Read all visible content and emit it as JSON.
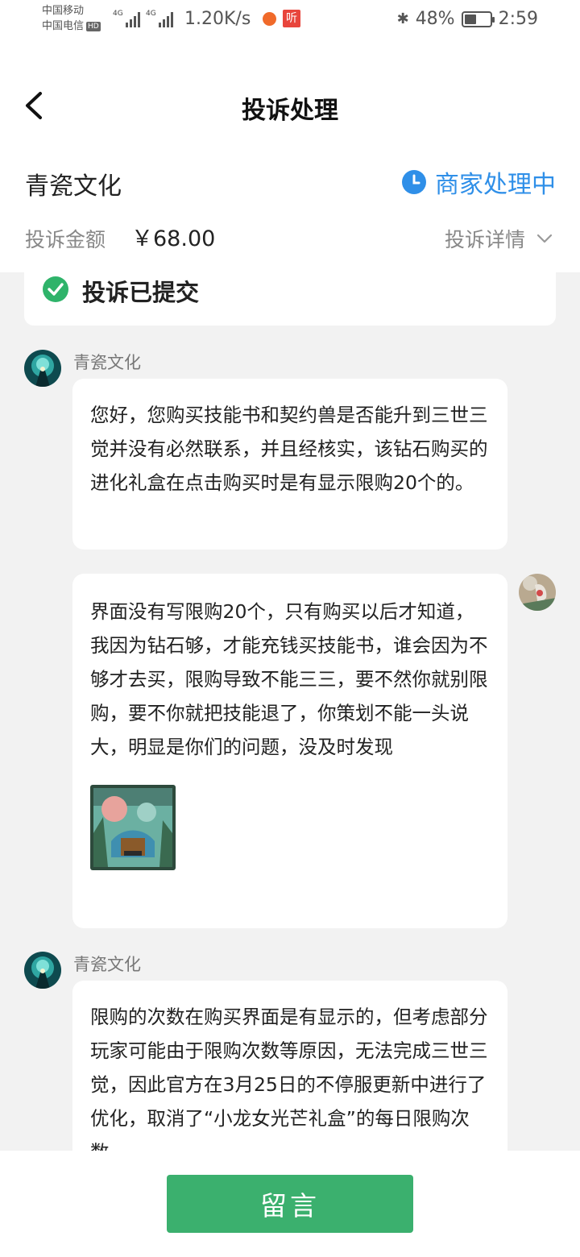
{
  "status_bar": {
    "carrier1": "中国移动",
    "carrier2": "中国电信",
    "hd_badge": "HD",
    "signal1_label": "4G",
    "signal2_label": "4G",
    "net_speed": "1.20K/s",
    "app_badge": "听",
    "battery": "48%",
    "battery_level": 0.48,
    "time": "2:59"
  },
  "header": {
    "title": "投诉处理",
    "merchant_name": "青瓷文化",
    "status_text": "商家处理中",
    "amount_label": "投诉金额",
    "amount_value": "￥68.00",
    "detail_link": "投诉详情"
  },
  "submitted": {
    "text": "投诉已提交"
  },
  "messages": [
    {
      "sender": "青瓷文化",
      "text": "您好，您购买技能书和契约兽是否能升到三世三觉并没有必然联系，并且经核实，该钻石购买的进化礼盒在点击购买时是有显示限购20个的。"
    },
    {
      "sender": "",
      "text": "界面没有写限购20个，只有购买以后才知道，我因为钻石够，才能充钱买技能书，谁会因为不够才去买，限购导致不能三三，要不然你就别限购，要不你就把技能退了，你策划不能一头说大，明显是你们的问题，没及时发现"
    },
    {
      "sender": "青瓷文化",
      "text": "限购的次数在购买界面是有显示的，但考虑部分玩家可能由于限购次数等原因，无法完成三世三觉，因此官方在3月25日的不停服更新中进行了优化，取消了“小龙女光芒礼盒”的每日限购次数。"
    }
  ],
  "footer": {
    "button_label": "留言"
  },
  "colors": {
    "accent_green": "#3bb06e",
    "status_blue": "#2f8fe8",
    "background": "#f2f2f2"
  }
}
